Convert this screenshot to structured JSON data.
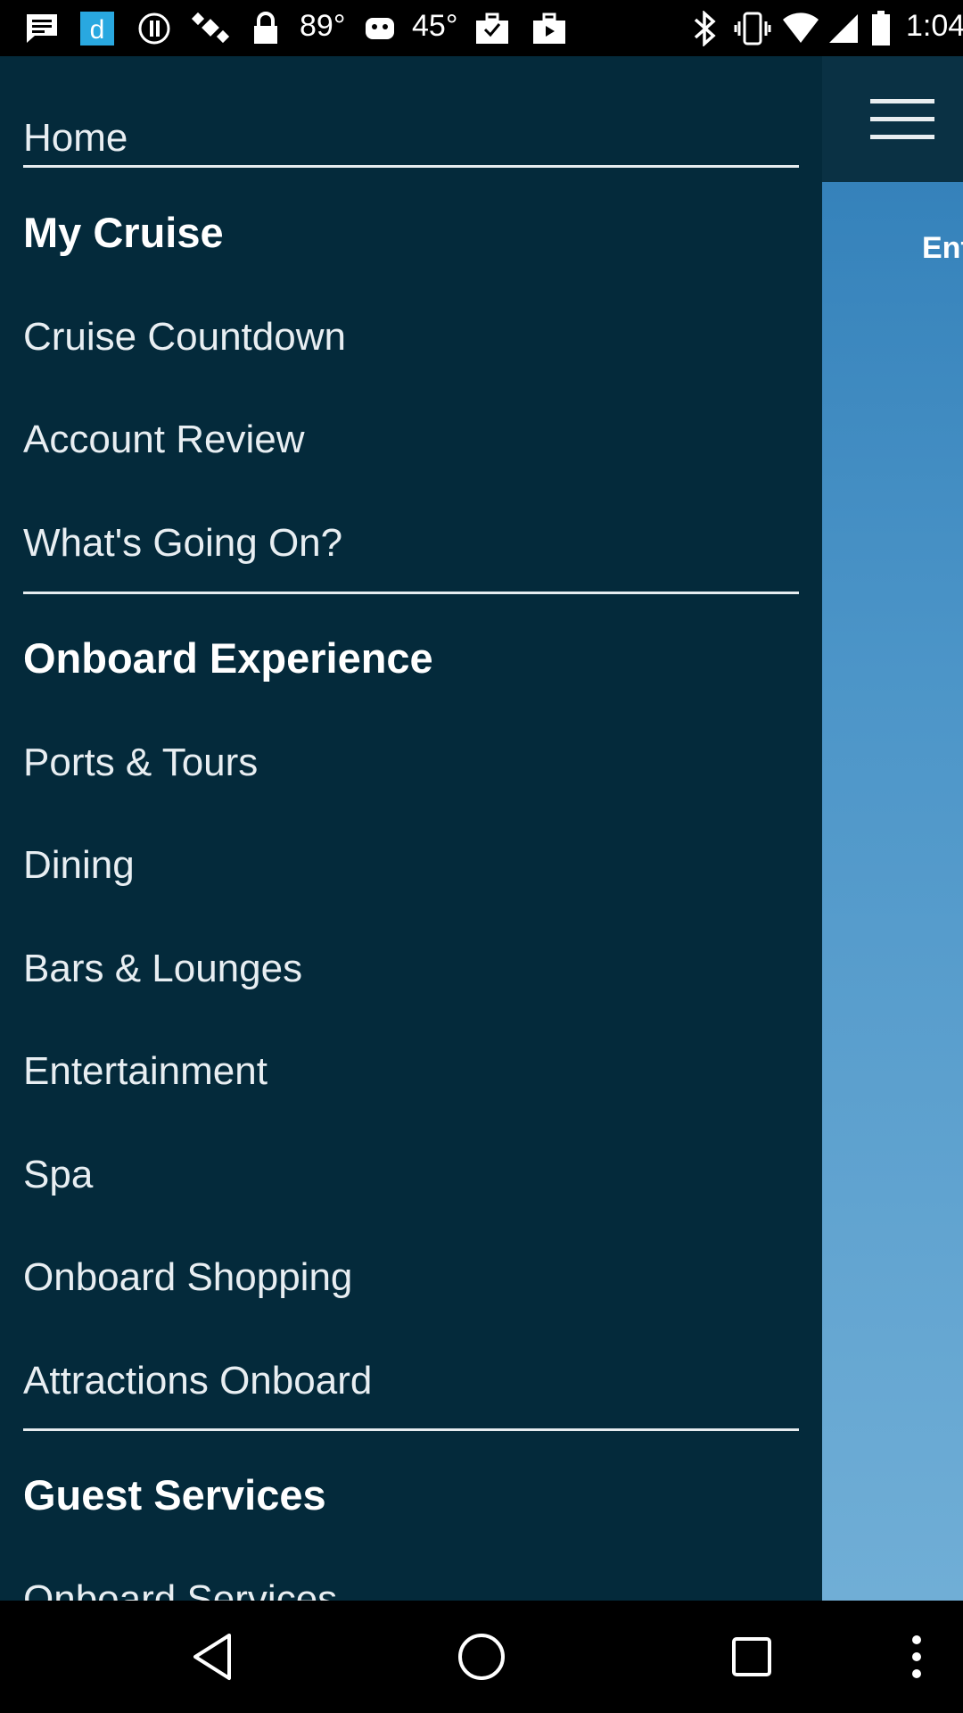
{
  "status_bar": {
    "temp1": "89°",
    "temp2": "45°",
    "time": "1:04",
    "icons": [
      "message-icon",
      "app-d-icon",
      "info-icon",
      "satellite-icon",
      "lock-icon",
      "weather-icon",
      "check-bag-icon",
      "briefcase-icon",
      "bluetooth-icon",
      "vibrate-icon",
      "wifi-icon",
      "signal-icon",
      "battery-icon"
    ]
  },
  "app": {
    "menu_icon": "hamburger-menu-icon",
    "peek_text": "Ent"
  },
  "drawer": {
    "home": "Home",
    "sections": [
      {
        "header": "My Cruise",
        "items": [
          "Cruise Countdown",
          "Account Review",
          "What's Going On?"
        ]
      },
      {
        "header": "Onboard Experience",
        "items": [
          "Ports & Tours",
          "Dining",
          "Bars & Lounges",
          "Entertainment",
          "Spa",
          "Onboard Shopping",
          "Attractions Onboard"
        ]
      },
      {
        "header": "Guest Services",
        "items": [
          "Onboard Services"
        ]
      }
    ]
  },
  "nav_bar": {
    "buttons": [
      "back-icon",
      "home-icon",
      "recents-icon",
      "more-options-icon"
    ]
  },
  "colors": {
    "drawer_bg": "#042a3b",
    "header_bg": "#0a3144",
    "accent_blue": "#4c95c8",
    "text": "#e8eef2"
  }
}
